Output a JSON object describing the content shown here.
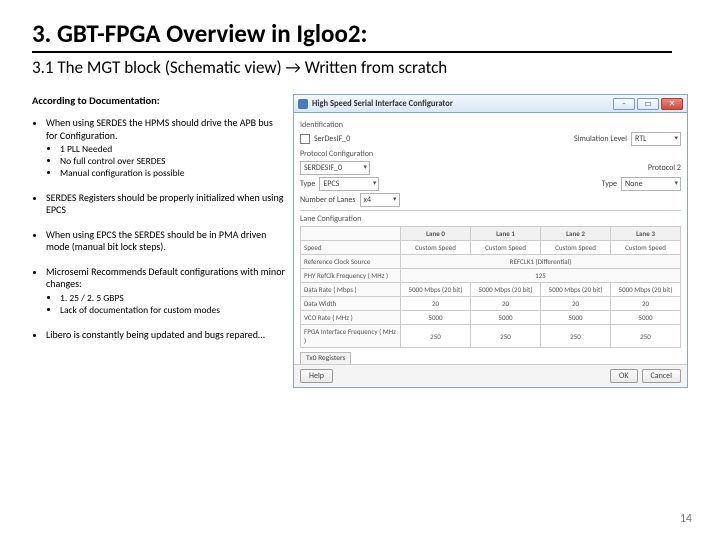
{
  "title": "3. GBT-FPGA Overview in Igloo2:",
  "subtitle": "3.1 The MGT block (Schematic view) → Written from scratch",
  "doc_heading": "According to Documentation:",
  "bullets": {
    "b1": "When using SERDES the HPMS should drive the APB bus for Configuration.",
    "b1a": "1 PLL Needed",
    "b1b": "No full control over SERDES",
    "b1c": "Manual configuration is possible",
    "b2": "SERDES Registers should be properly initialized when using EPCS",
    "b3": "When using EPCS the SERDES should be in PMA driven mode (manual bit lock steps).",
    "b4": "Microsemi Recommends Default configurations with minor changes:",
    "b4a": "1. 25 / 2. 5 GBPS",
    "b4b": "Lack of documentation for custom modes",
    "b5": "Libero is constantly being updated and bugs repared…"
  },
  "win": {
    "title": "High Speed Serial Interface Configurator",
    "identification": "Identification",
    "serdes_label": "SerDesIF_0",
    "protocol": "Protocol Configuration",
    "serdes_sel": "SERDESIF_0",
    "type_lbl": "Type",
    "type_val": "EPCS",
    "proto2_lbl": "Protocol 2",
    "proto2_type": "Type",
    "proto2_val": "None",
    "lanes_lbl": "Number of Lanes",
    "lanes_val": "x4",
    "sim_lbl": "Simulation Level",
    "sim_val": "RTL",
    "laneconf": "Lane Configuration",
    "headers": {
      "l0": "Lane 0",
      "l1": "Lane 1",
      "l2": "Lane 2",
      "l3": "Lane 3"
    },
    "rows": {
      "speed": {
        "lbl": "Speed",
        "v": "Custom Speed"
      },
      "refclk": {
        "lbl": "Reference Clock Source",
        "v": "REFCLK1 (Differential)"
      },
      "refref": {
        "lbl": "PHY RefClk Frequency ( MHz )",
        "v": "125"
      },
      "rate": {
        "lbl": "Data Rate ( Mbps )",
        "v0": "5000 Mbps (20 bit)",
        "v1": "5000 Mbps (20 bit)",
        "v2": "5000 Mbps (20 bit)",
        "v3": "5000 Mbps (20 bit)"
      },
      "width": {
        "lbl": "Data Width",
        "v": "20"
      },
      "vco": {
        "lbl": "VCO Rate ( MHz )",
        "v": "5000"
      },
      "fpga": {
        "lbl": "FPGA Interface Frequency ( MHz )",
        "v": "250"
      }
    },
    "tab": "Tx0 Registers",
    "help": "Help",
    "ok": "OK",
    "cancel": "Cancel"
  },
  "page": "14"
}
